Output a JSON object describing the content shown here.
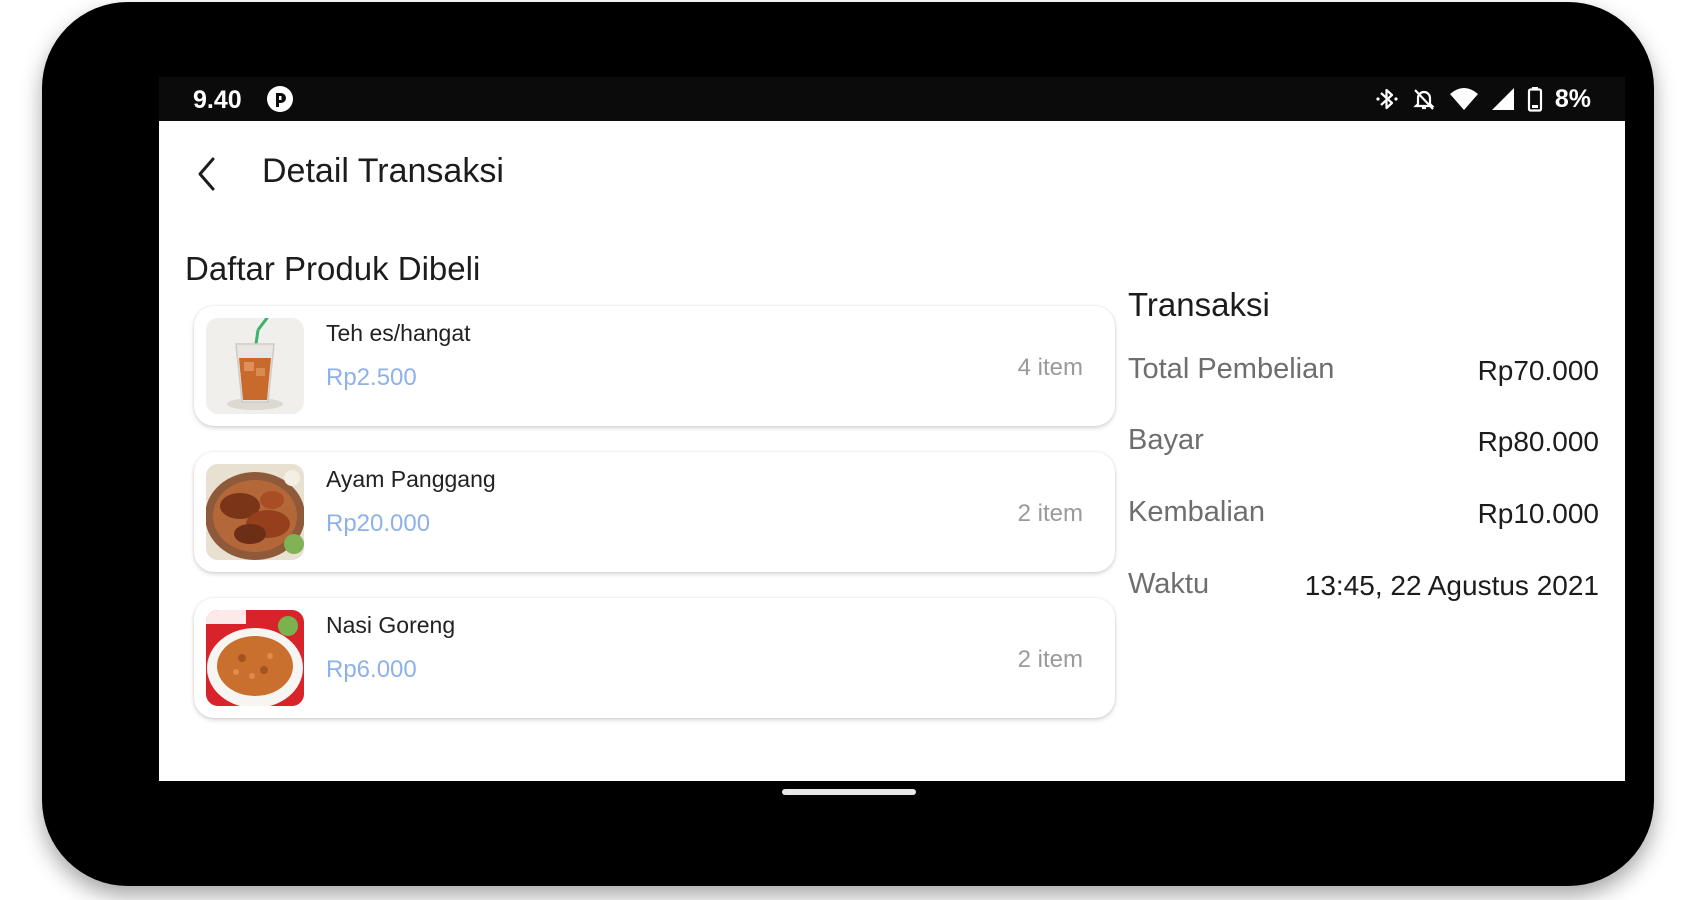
{
  "status_bar": {
    "time": "9.40",
    "battery": "8%",
    "icons": [
      "app-notification-icon",
      "bluetooth-icon",
      "silent-icon",
      "wifi-icon",
      "signal-icon",
      "battery-icon"
    ]
  },
  "app_bar": {
    "back_icon": "back-arrow-icon",
    "title": "Detail Transaksi"
  },
  "products_section": {
    "title": "Daftar Produk Dibeli",
    "items": [
      {
        "name": "Teh es/hangat",
        "price": "Rp2.500",
        "qty": "4 item",
        "image": "iced-tea"
      },
      {
        "name": "Ayam Panggang",
        "price": "Rp20.000",
        "qty": "2 item",
        "image": "grilled-chicken"
      },
      {
        "name": "Nasi Goreng",
        "price": "Rp6.000",
        "qty": "2 item",
        "image": "fried-rice"
      }
    ]
  },
  "transaction": {
    "title": "Transaksi",
    "rows": [
      {
        "label": "Total Pembelian",
        "value": "Rp70.000"
      },
      {
        "label": "Bayar",
        "value": "Rp80.000"
      },
      {
        "label": "Kembalian",
        "value": "Rp10.000"
      },
      {
        "label": "Waktu",
        "value": "13:45, 22 Agustus 2021"
      }
    ]
  },
  "colors": {
    "price": "#8eb1ea",
    "quantity": "#9a9a9a",
    "label": "#6e6e6e",
    "text": "#1c1c1c"
  }
}
